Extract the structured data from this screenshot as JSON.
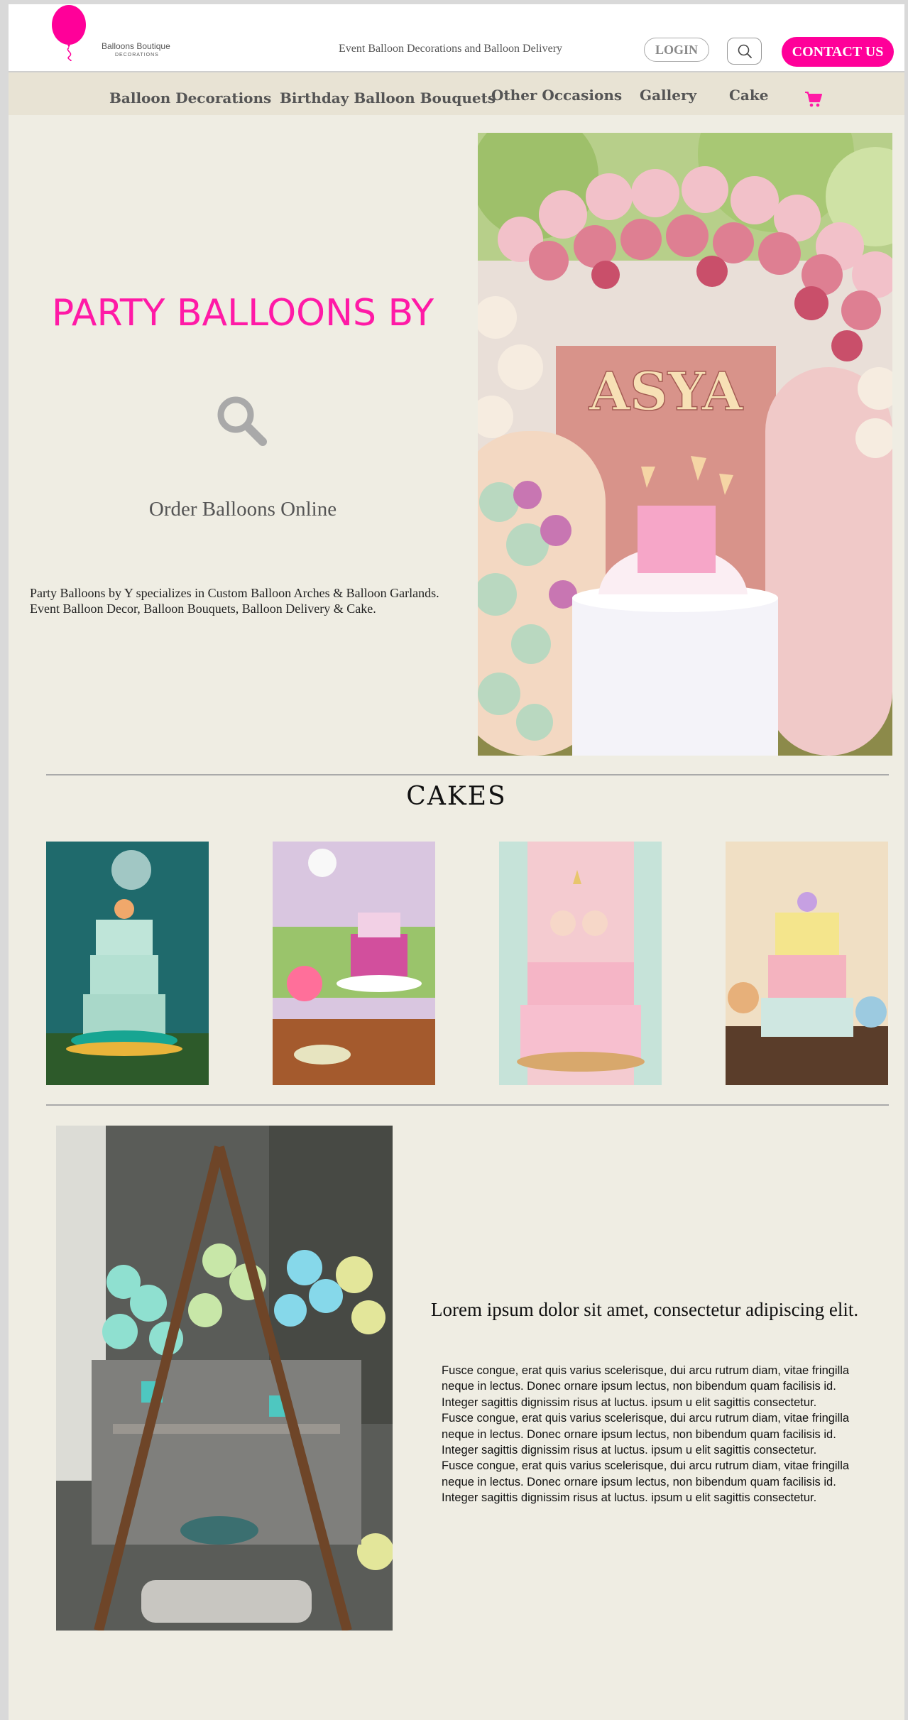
{
  "header": {
    "brand_name": "Balloons Boutique",
    "brand_sub": "DECORATIONS",
    "tagline": "Event Balloon Decorations and Balloon Delivery",
    "login_label": "LOGIN",
    "contact_label": "CONTACT US",
    "accent_color": "#ff0099"
  },
  "nav": {
    "items": [
      {
        "label": "Balloon Decorations"
      },
      {
        "label": "Birthday Balloon Bouquets"
      },
      {
        "label": "Other Occasions"
      },
      {
        "label": "Gallery"
      },
      {
        "label": "Cake"
      }
    ],
    "cart_icon": "shopping-cart-icon"
  },
  "hero": {
    "title": "PARTY BALLOONS BY",
    "subtitle": "Order Balloons Online",
    "description_line1": "Party Balloons by Y specializes in Custom Balloon Arches & Balloon Garlands.",
    "description_line2": "Event Balloon Decor, Balloon Bouquets, Balloon Delivery & Cake.",
    "image_sign_text": "ASYA"
  },
  "cakes": {
    "title": "CAKES"
  },
  "feature": {
    "title": "Lorem ipsum dolor sit amet, consectetur adipiscing elit.",
    "body": [
      "Fusce congue, erat quis varius scelerisque, dui arcu rutrum diam, vitae fringilla",
      "neque in lectus. Donec ornare ipsum lectus, non bibendum quam facilisis id.",
      "Integer sagittis dignissim risus at luctus. ipsum u elit sagittis consectetur.",
      "Fusce congue, erat quis varius scelerisque, dui arcu rutrum diam, vitae fringilla",
      "neque in lectus. Donec ornare ipsum lectus, non bibendum quam facilisis id.",
      "Integer sagittis dignissim risus at luctus. ipsum u elit sagittis consectetur.",
      "Fusce congue, erat quis varius scelerisque, dui arcu rutrum diam, vitae fringilla",
      "neque in lectus. Donec ornare ipsum lectus, non bibendum quam facilisis id.",
      "Integer sagittis dignissim risus at luctus. ipsum u elit sagittis consectetur."
    ]
  }
}
